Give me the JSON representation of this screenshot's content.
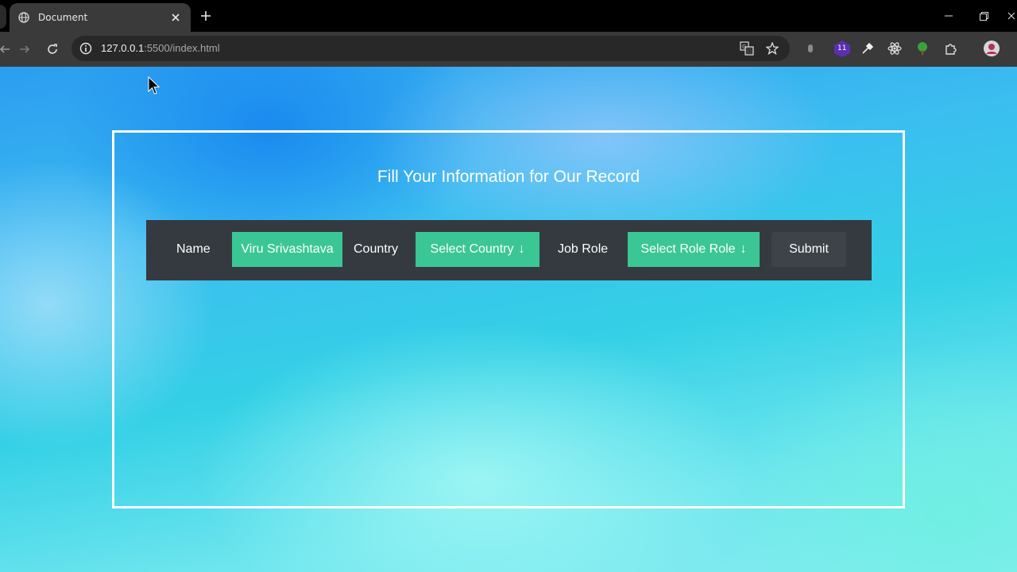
{
  "browser": {
    "tab": {
      "title": "Document",
      "favicon": "globe-icon"
    },
    "address_bar": {
      "host": "127.0.0.1",
      "path": ":5500/index.html"
    },
    "extension_badge": "11",
    "colors": {
      "frame": "#000000",
      "toolbar": "#3a3a3a",
      "omnibox": "#282828"
    }
  },
  "page": {
    "title": "Fill Your Information for Our Record",
    "form": {
      "name_label": "Name",
      "name_value": "Viru Srivashtava",
      "country_label": "Country",
      "country_select": "Select Country",
      "job_role_label": "Job Role",
      "job_role_select": "Select Role Role",
      "submit_label": "Submit",
      "dropdown_arrow": "↓"
    },
    "colors": {
      "field": "#3ac795",
      "bar": "#343a40",
      "border": "#ffffff"
    }
  }
}
